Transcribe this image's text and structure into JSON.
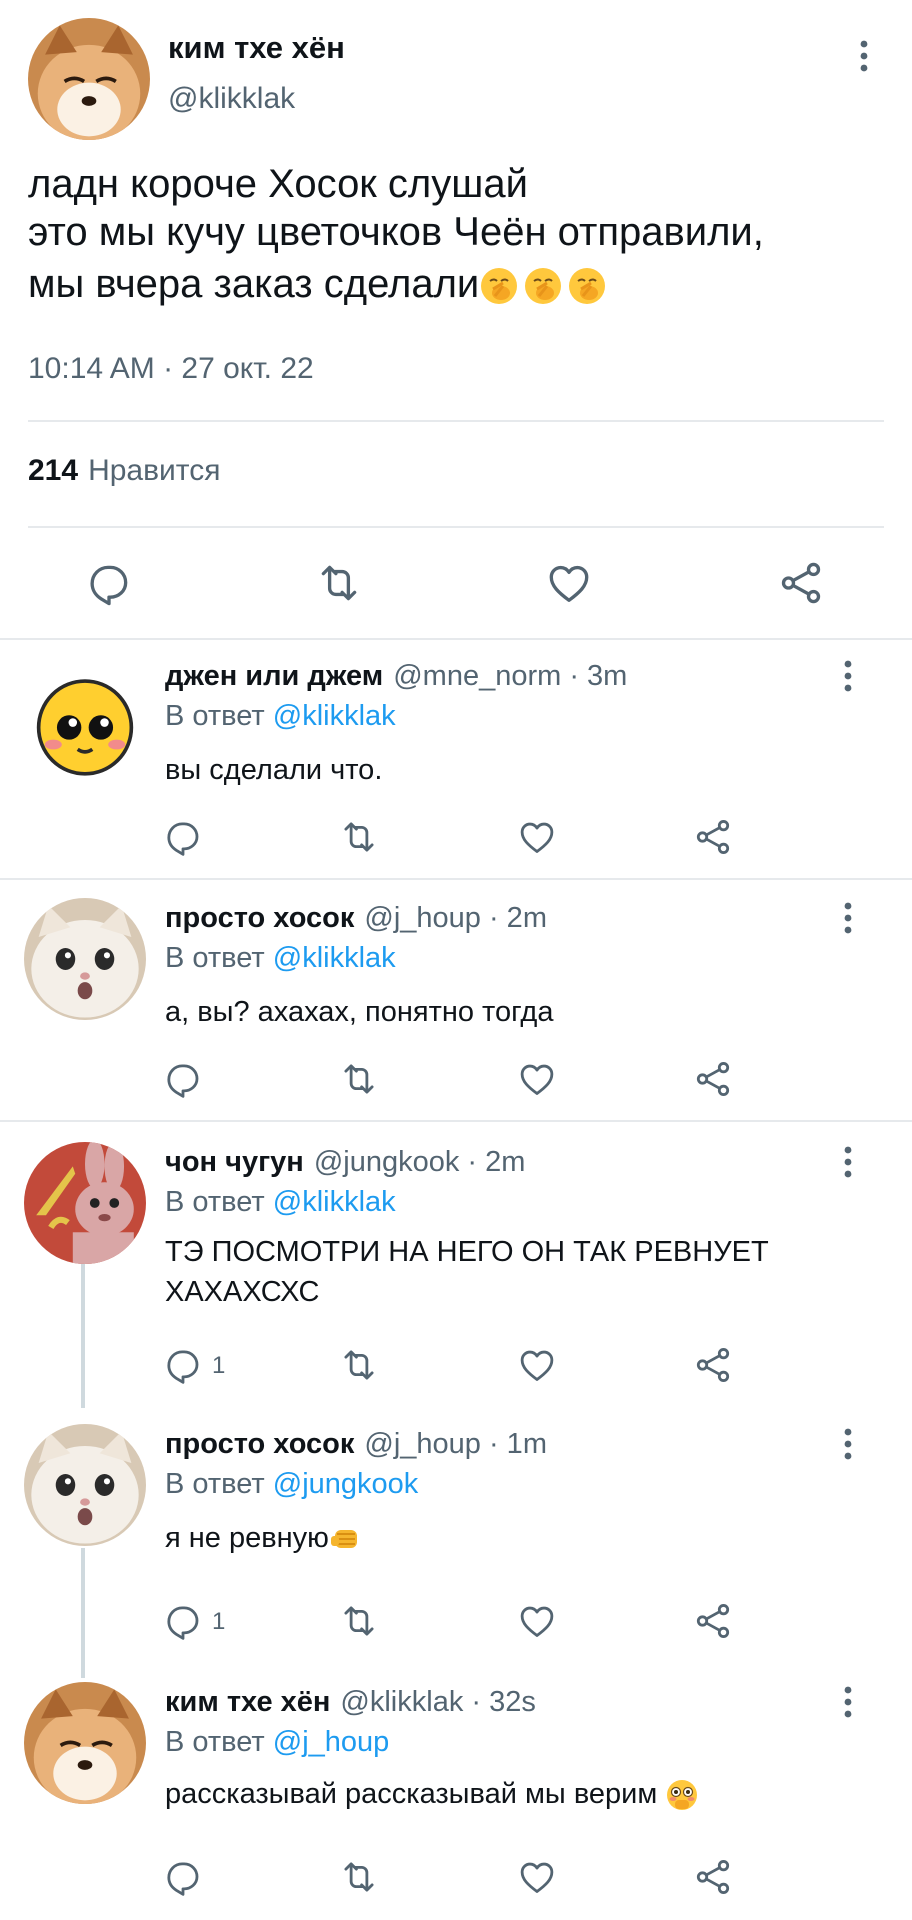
{
  "main_tweet": {
    "name": "ким тхе хён",
    "handle": "@klikklak",
    "text_lines": [
      "ладн короче Хосок слушай",
      "это мы кучу цветочков Чеён отправили,",
      "мы вчера заказ сделали"
    ],
    "text_emoji": "yawning-face",
    "time": "10:14 AM · 27 окт. 22",
    "likes_count": "214",
    "likes_label": "Нравится"
  },
  "replies": [
    {
      "name": "джен или джем",
      "handle": "@mne_norm · 3m",
      "reply_prefix": "В ответ",
      "reply_to": "@klikklak",
      "text_lines": [
        "вы сделали что."
      ],
      "reply_count": "",
      "avatar": "cute-emoji-face"
    },
    {
      "name": "просто хосок",
      "handle": "@j_houp · 2m",
      "reply_prefix": "В ответ",
      "reply_to": "@klikklak",
      "text_lines": [
        "а, вы? ахахах, понятно тогда"
      ],
      "reply_count": "",
      "avatar": "white-cat"
    },
    {
      "name": "чон чугун",
      "handle": "@jungkook · 2m",
      "reply_prefix": "В ответ",
      "reply_to": "@klikklak",
      "text_lines": [
        "ТЭ ПОСМОТРИ НА НЕГО ОН ТАК РЕВНУЕТ",
        "ХАХАХСХС"
      ],
      "reply_count": "1",
      "avatar": "bunny"
    },
    {
      "name": "просто хосок",
      "handle": "@j_houp · 1m",
      "reply_prefix": "В ответ",
      "reply_to": "@jungkook",
      "text_lines": [
        "я не ревную"
      ],
      "text_emoji": "fist",
      "reply_count": "1",
      "avatar": "white-cat"
    },
    {
      "name": "ким тхе хён",
      "handle": "@klikklak · 32s",
      "reply_prefix": "В ответ",
      "reply_to": "@j_houp",
      "text_lines": [
        "рассказывай рассказывай мы верим"
      ],
      "text_emoji": "flushed-face",
      "reply_count": "",
      "avatar": "shiba-dog"
    }
  ],
  "colors": {
    "accent": "#1d9bf0",
    "muted": "#536471",
    "divider": "#e6e9ec",
    "text": "#0f1419"
  }
}
